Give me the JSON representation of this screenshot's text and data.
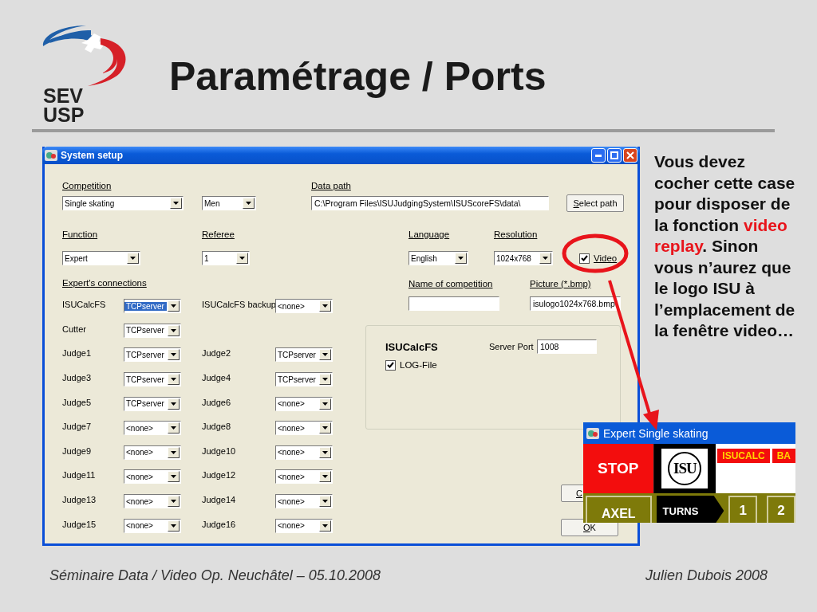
{
  "slide": {
    "title": "Paramétrage / Ports",
    "logo": {
      "line_1": "SEV",
      "line_2": "USP"
    }
  },
  "window": {
    "title": "System setup",
    "competition": {
      "label": "Competition",
      "type": "Single skating",
      "category": "Men"
    },
    "data_path": {
      "label": "Data path",
      "value": "C:\\Program Files\\ISUJudgingSystem\\ISUScoreFS\\data\\",
      "button": "Select path"
    },
    "function": {
      "label": "Function",
      "value": "Expert"
    },
    "referee": {
      "label": "Referee",
      "value": "1"
    },
    "language": {
      "label": "Language",
      "value": "English"
    },
    "resolution": {
      "label": "Resolution",
      "value": "1024x768"
    },
    "video": {
      "label": "Video",
      "checked": true
    },
    "connections": {
      "label": "Expert's connections",
      "rows": [
        {
          "cells": [
            {
              "name": "ISUCalcFS",
              "value": "TCPserver",
              "selected": true
            },
            {
              "name": "ISUCalcFS backup",
              "value": "<none>",
              "selected": false
            }
          ]
        },
        {
          "cells": [
            {
              "name": "Cutter",
              "value": "TCPserver",
              "selected": false
            }
          ]
        },
        {
          "cells": [
            {
              "name": "Judge1",
              "value": "TCPserver",
              "selected": false
            },
            {
              "name": "Judge2",
              "value": "TCPserver",
              "selected": false
            }
          ]
        },
        {
          "cells": [
            {
              "name": "Judge3",
              "value": "TCPserver",
              "selected": false
            },
            {
              "name": "Judge4",
              "value": "TCPserver",
              "selected": false
            }
          ]
        },
        {
          "cells": [
            {
              "name": "Judge5",
              "value": "TCPserver",
              "selected": false
            },
            {
              "name": "Judge6",
              "value": "<none>",
              "selected": false
            }
          ]
        },
        {
          "cells": [
            {
              "name": "Judge7",
              "value": "<none>",
              "selected": false
            },
            {
              "name": "Judge8",
              "value": "<none>",
              "selected": false
            }
          ]
        },
        {
          "cells": [
            {
              "name": "Judge9",
              "value": "<none>",
              "selected": false
            },
            {
              "name": "Judge10",
              "value": "<none>",
              "selected": false
            }
          ]
        },
        {
          "cells": [
            {
              "name": "Judge11",
              "value": "<none>",
              "selected": false
            },
            {
              "name": "Judge12",
              "value": "<none>",
              "selected": false
            }
          ]
        },
        {
          "cells": [
            {
              "name": "Judge13",
              "value": "<none>",
              "selected": false
            },
            {
              "name": "Judge14",
              "value": "<none>",
              "selected": false
            }
          ]
        },
        {
          "cells": [
            {
              "name": "Judge15",
              "value": "<none>",
              "selected": false
            },
            {
              "name": "Judge16",
              "value": "<none>",
              "selected": false
            }
          ]
        }
      ]
    },
    "competition_name": {
      "label": "Name of competition"
    },
    "picture": {
      "label": "Picture (*.bmp)",
      "value": "isulogo1024x768.bmp"
    },
    "group": {
      "title": "ISUCalcFS",
      "port_label": "Server Port",
      "port": "1008",
      "log_file": {
        "label": "LOG-File",
        "checked": true
      }
    },
    "buttons": [
      "C",
      "OK"
    ]
  },
  "note": [
    {
      "text": "Vous devez cocher cette case pour disposer de la fonction ",
      "highlight": false
    },
    {
      "text": "video replay",
      "highlight": true
    },
    {
      "text": ". Sinon vous n’aurez que le logo ISU à l’emplacement de la fenêtre video…",
      "highlight": false
    }
  ],
  "inset": {
    "title": "Expert Single skating",
    "stop": "STOP",
    "logo": "ISU",
    "tags": [
      "ISUCALC",
      "BA"
    ],
    "element": "AXEL",
    "turns": "TURNS",
    "counts": [
      "1",
      "2"
    ]
  },
  "footer": {
    "left": "Séminaire Data / Video Op. Neuchâtel – 05.10.2008",
    "right": "Julien Dubois 2008"
  }
}
